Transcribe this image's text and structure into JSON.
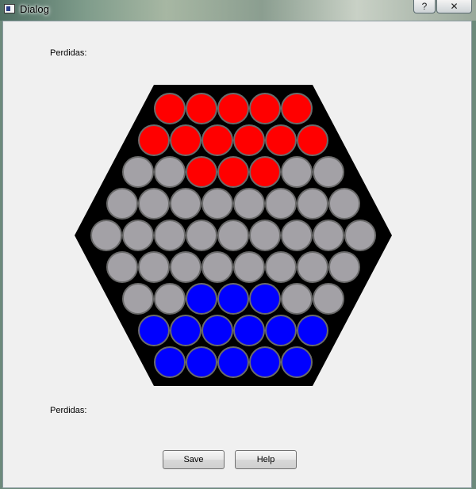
{
  "window": {
    "title": "Dialog",
    "help_button": "?",
    "close_button": "✕"
  },
  "labels": {
    "top_losses": "Perdidas:",
    "bottom_losses": "Perdidas:"
  },
  "buttons": {
    "save": "Save",
    "help": "Help"
  },
  "colors": {
    "red": "#ff0000",
    "blue": "#0000ff",
    "empty": "#a3a1a6",
    "board": "#000000"
  },
  "board": {
    "rows": [
      [
        "R",
        "R",
        "R",
        "R",
        "R"
      ],
      [
        "R",
        "R",
        "R",
        "R",
        "R",
        "R"
      ],
      [
        "E",
        "E",
        "R",
        "R",
        "R",
        "E",
        "E"
      ],
      [
        "E",
        "E",
        "E",
        "E",
        "E",
        "E",
        "E",
        "E"
      ],
      [
        "E",
        "E",
        "E",
        "E",
        "E",
        "E",
        "E",
        "E",
        "E"
      ],
      [
        "E",
        "E",
        "E",
        "E",
        "E",
        "E",
        "E",
        "E"
      ],
      [
        "E",
        "E",
        "B",
        "B",
        "B",
        "E",
        "E"
      ],
      [
        "B",
        "B",
        "B",
        "B",
        "B",
        "B"
      ],
      [
        "B",
        "B",
        "B",
        "B",
        "B"
      ]
    ]
  }
}
